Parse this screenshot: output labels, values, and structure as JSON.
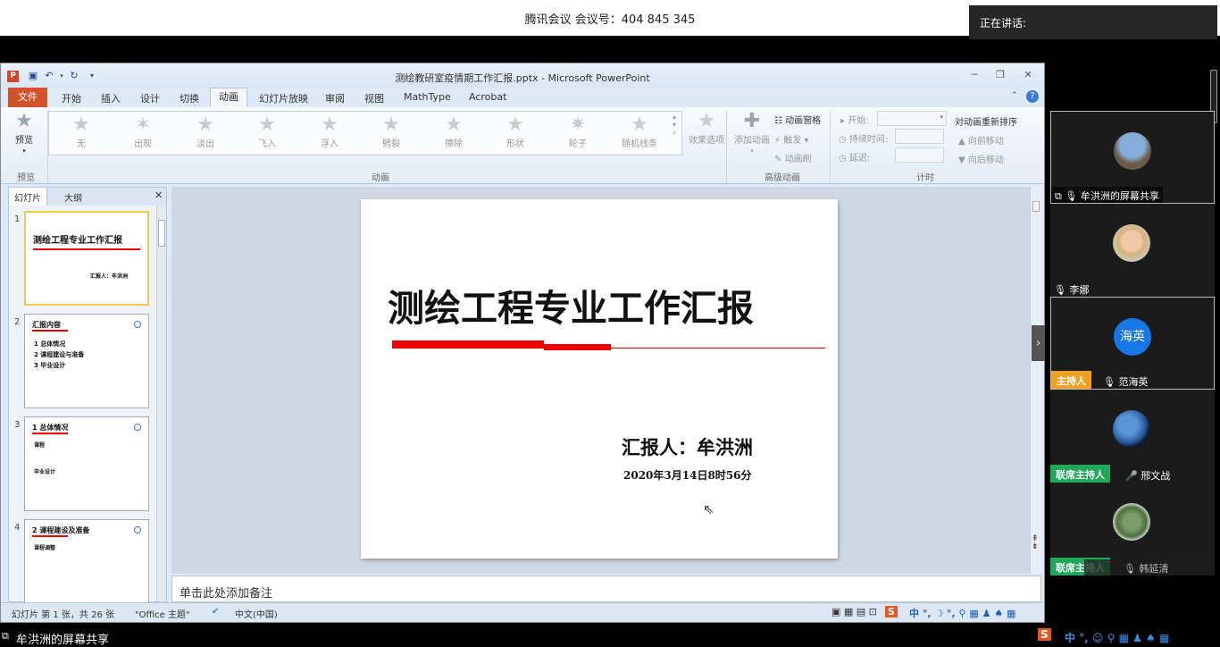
{
  "meeting": {
    "title": "腾讯会议 会议号：404 845 345",
    "speaking_label": "正在讲话:",
    "share_label": "牟洪洲的屏幕共享"
  },
  "ppt": {
    "app_icon": "P",
    "window_title": "测绘教研室疫情期工作汇报.pptx - Microsoft PowerPoint",
    "file_tab": "文件",
    "tabs": [
      "开始",
      "插入",
      "设计",
      "切换",
      "动画",
      "幻灯片放映",
      "审阅",
      "视图",
      "MathType",
      "Acrobat"
    ],
    "active_tab": "动画",
    "ribbon": {
      "preview": "预览",
      "preview_group": "预览",
      "animations": [
        "无",
        "出现",
        "淡出",
        "飞入",
        "浮入",
        "劈裂",
        "擦除",
        "形状",
        "轮子",
        "随机线条"
      ],
      "effect_options": "效果选项",
      "anim_group": "动画",
      "add_animation": "添加动画",
      "anim_pane": "动画窗格",
      "trigger": "触发",
      "anim_painter": "动画刷",
      "adv_group": "高级动画",
      "start": "开始:",
      "duration": "持续时间:",
      "delay": "延迟:",
      "timing_group": "计时",
      "reorder": "对动画重新排序",
      "move_earlier": "向前移动",
      "move_later": "向后移动"
    },
    "panel_tabs": [
      "幻灯片",
      "大纲"
    ],
    "thumbs": [
      {
        "num": "1",
        "title": "测绘工程专业工作汇报",
        "reporter": "汇报人：牟洪洲"
      },
      {
        "num": "2",
        "title": "汇报内容",
        "items": [
          "1 总体情况",
          "2 课程建设与准备",
          "3 毕业设计"
        ]
      },
      {
        "num": "3",
        "title": "1 总体情况",
        "items": [
          "课程",
          "毕业设计"
        ]
      },
      {
        "num": "4",
        "title": "2 课程建设及准备",
        "items": [
          "课程调整"
        ]
      }
    ],
    "slide": {
      "title": "测绘工程专业工作汇报",
      "reporter": "汇报人：牟洪洲",
      "date": "2020年3月14日8时56分"
    },
    "notes_placeholder": "单击此处添加备注",
    "status": {
      "slide_count": "幻灯片 第 1 张，共 26 张",
      "theme": "\"Office 主题\"",
      "language": "中文(中国)"
    }
  },
  "participants": [
    {
      "name": "牟洪洲的屏幕共享",
      "role": ""
    },
    {
      "name": "李娜",
      "role": ""
    },
    {
      "name": "范海英",
      "role": "主持人",
      "avatar_text": "海英"
    },
    {
      "name": "邢文战",
      "role": "联席主持人"
    },
    {
      "name": "韩延清",
      "role": "联席主持人"
    }
  ]
}
